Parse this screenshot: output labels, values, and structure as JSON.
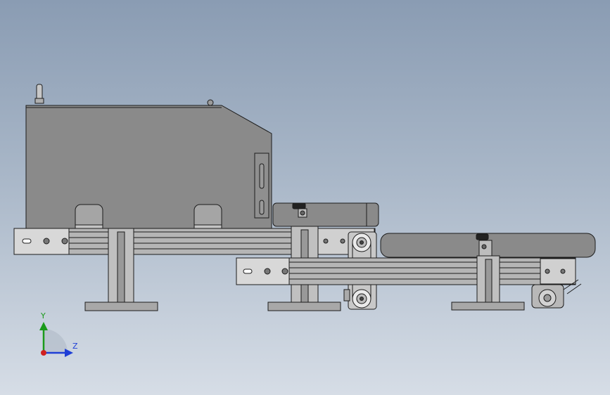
{
  "triad": {
    "y_label": "Y",
    "z_label": "Z",
    "y_color": "#1a9a1a",
    "z_color": "#1f3fd6",
    "x_color": "#d02020"
  },
  "colors": {
    "background_top": "#8a9cb3",
    "background_bottom": "#d6dde6",
    "housing": "#8a8a8a",
    "rail": "#a9a9a9",
    "outline": "#1c1c1c"
  }
}
